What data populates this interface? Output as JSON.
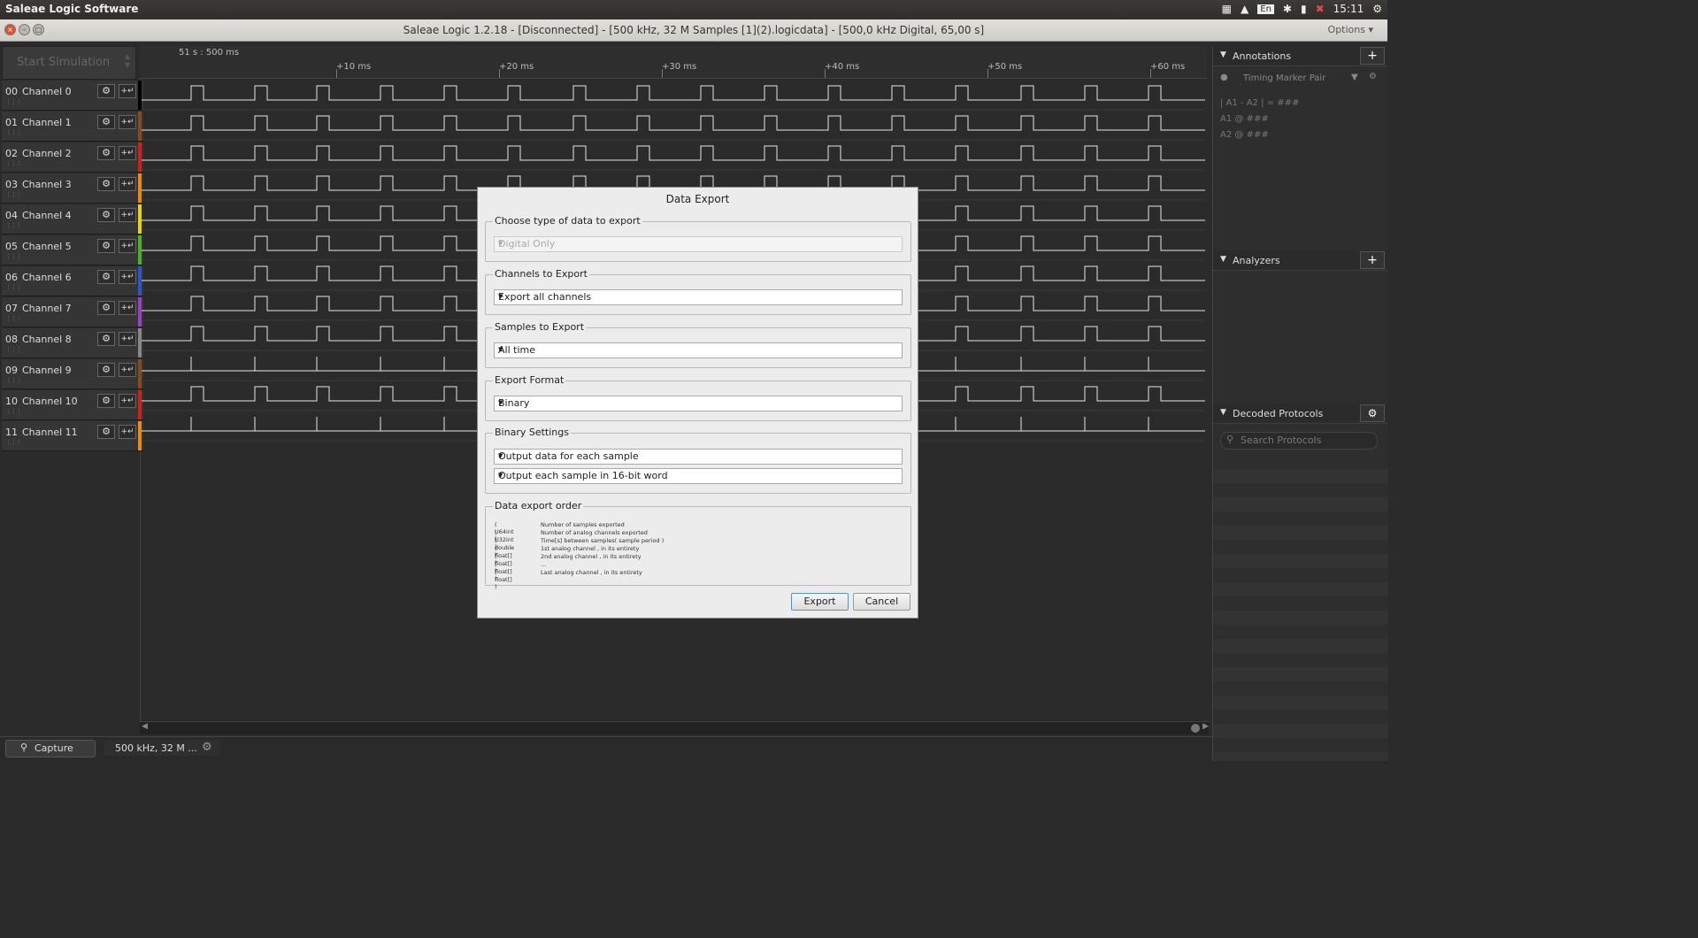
{
  "system": {
    "app_name": "Saleae Logic Software",
    "keyboard_layout": "En",
    "clock": "15:11"
  },
  "window": {
    "title": "Saleae Logic 1.2.18 - [Disconnected] - [500 kHz, 32 M Samples [1](2).logicdata] - [500,0 kHz Digital, 65,00 s]",
    "options_label": "Options ▾"
  },
  "toolbar": {
    "start_simulation": "Start Simulation"
  },
  "ruler": {
    "start_time": "51 s : 500 ms",
    "ticks": [
      "+10 ms",
      "+20 ms",
      "+30 ms",
      "+40 ms",
      "+50 ms",
      "+60 ms"
    ]
  },
  "channels": [
    {
      "num": "00",
      "name": "Channel 0",
      "color": "#000000"
    },
    {
      "num": "01",
      "name": "Channel 1",
      "color": "#8b4a1c"
    },
    {
      "num": "02",
      "name": "Channel 2",
      "color": "#d0201c"
    },
    {
      "num": "03",
      "name": "Channel 3",
      "color": "#e88a1a"
    },
    {
      "num": "04",
      "name": "Channel 4",
      "color": "#e8d11a"
    },
    {
      "num": "05",
      "name": "Channel 5",
      "color": "#4fae2c"
    },
    {
      "num": "06",
      "name": "Channel 6",
      "color": "#2b58c9"
    },
    {
      "num": "07",
      "name": "Channel 7",
      "color": "#9b3fc8"
    },
    {
      "num": "08",
      "name": "Channel 8",
      "color": "#888888"
    },
    {
      "num": "09",
      "name": "Channel 9",
      "color": "#8b4a1c"
    },
    {
      "num": "10",
      "name": "Channel 10",
      "color": "#d0201c"
    },
    {
      "num": "11",
      "name": "Channel 11",
      "color": "#e88a1a"
    }
  ],
  "bottom": {
    "capture_tab": "Capture",
    "session_tab": "500 kHz, 32 M ..."
  },
  "right_panel": {
    "annotations_title": "Annotations",
    "timing_marker": "Timing Marker Pair",
    "ann_line1": "| A1 - A2 | = ###",
    "ann_line2": "A1  @  ###",
    "ann_line3": "A2  @  ###",
    "analyzers_title": "Analyzers",
    "decoded_title": "Decoded Protocols",
    "search_placeholder": "Search Protocols"
  },
  "dialog": {
    "title": "Data Export",
    "type_legend": "Choose type of data to export",
    "type_value": "Digital Only",
    "channels_legend": "Channels to Export",
    "channels_value": "Export all channels",
    "samples_legend": "Samples to Export",
    "samples_value": "All time",
    "format_legend": "Export Format",
    "format_value": "Binary",
    "binary_legend": "Binary Settings",
    "binary_value1": "Output data for each sample",
    "binary_value2": "Output each sample in 16-bit word",
    "order_legend": "Data export order",
    "order_rows": [
      {
        "type": "( U64int )",
        "desc": "Number of samples exported"
      },
      {
        "type": "( U32int )",
        "desc": "Number of analog channels exported"
      },
      {
        "type": "( double )",
        "desc": "Time[s] between samples( sample period )"
      },
      {
        "type": "( float[] )",
        "desc": "1st analog channel , in its entirety"
      },
      {
        "type": "( float[] )",
        "desc": "2nd analog channel , in its entirety"
      },
      {
        "type": "( float[] )",
        "desc": "..."
      },
      {
        "type": "( float[] )",
        "desc": "Last analog channel , in its entirety"
      }
    ],
    "export_label": "Export",
    "cancel_label": "Cancel"
  }
}
